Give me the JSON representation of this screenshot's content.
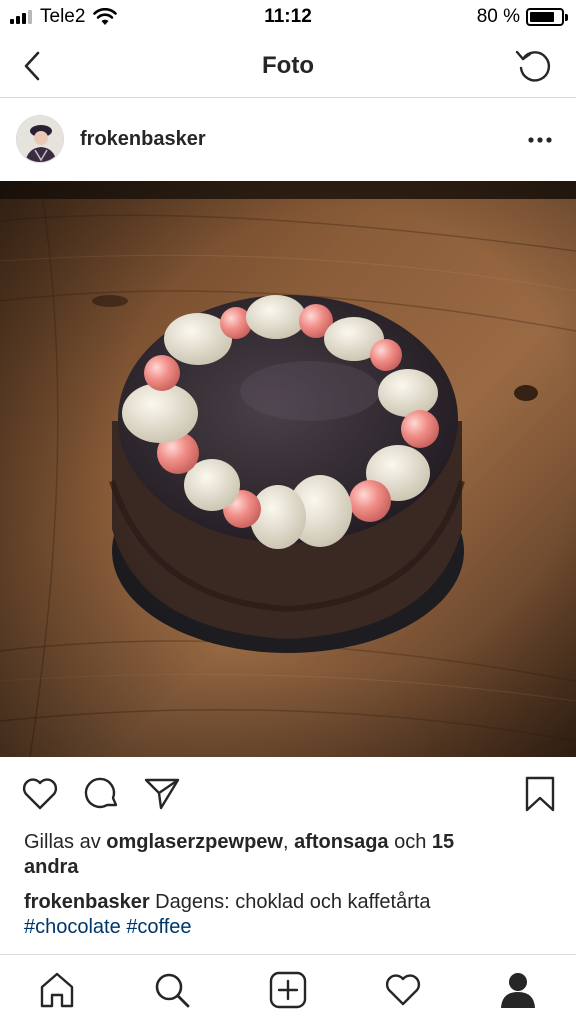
{
  "status_bar": {
    "carrier": "Tele2",
    "time": "11:12",
    "battery_text": "80 %",
    "battery_level": 0.8
  },
  "nav": {
    "title": "Foto",
    "back_icon": "chevron-left-icon",
    "refresh_icon": "refresh-icon"
  },
  "post": {
    "username": "frokenbasker",
    "more_icon": "more-horizontal-icon",
    "photo_icon": "cake-photo"
  },
  "likes": {
    "prefix": "Gillas av ",
    "user1": "omglaserzpewpew",
    "separator": ", ",
    "user2": "aftonsaga",
    "middle": " och ",
    "count": "15",
    "suffix": "andra"
  },
  "caption": {
    "username": "frokenbasker",
    "text": " Dagens: choklad och kaffetårta",
    "hashtags": [
      "#chocolate",
      "#coffee"
    ]
  },
  "tabs": [
    {
      "icon": "home-icon"
    },
    {
      "icon": "search-icon"
    },
    {
      "icon": "add-icon"
    },
    {
      "icon": "heart-icon"
    },
    {
      "icon": "profile-icon"
    }
  ],
  "colors": {
    "text": "#262626",
    "hashtag": "#003569",
    "divider": "#dbdbdb"
  }
}
